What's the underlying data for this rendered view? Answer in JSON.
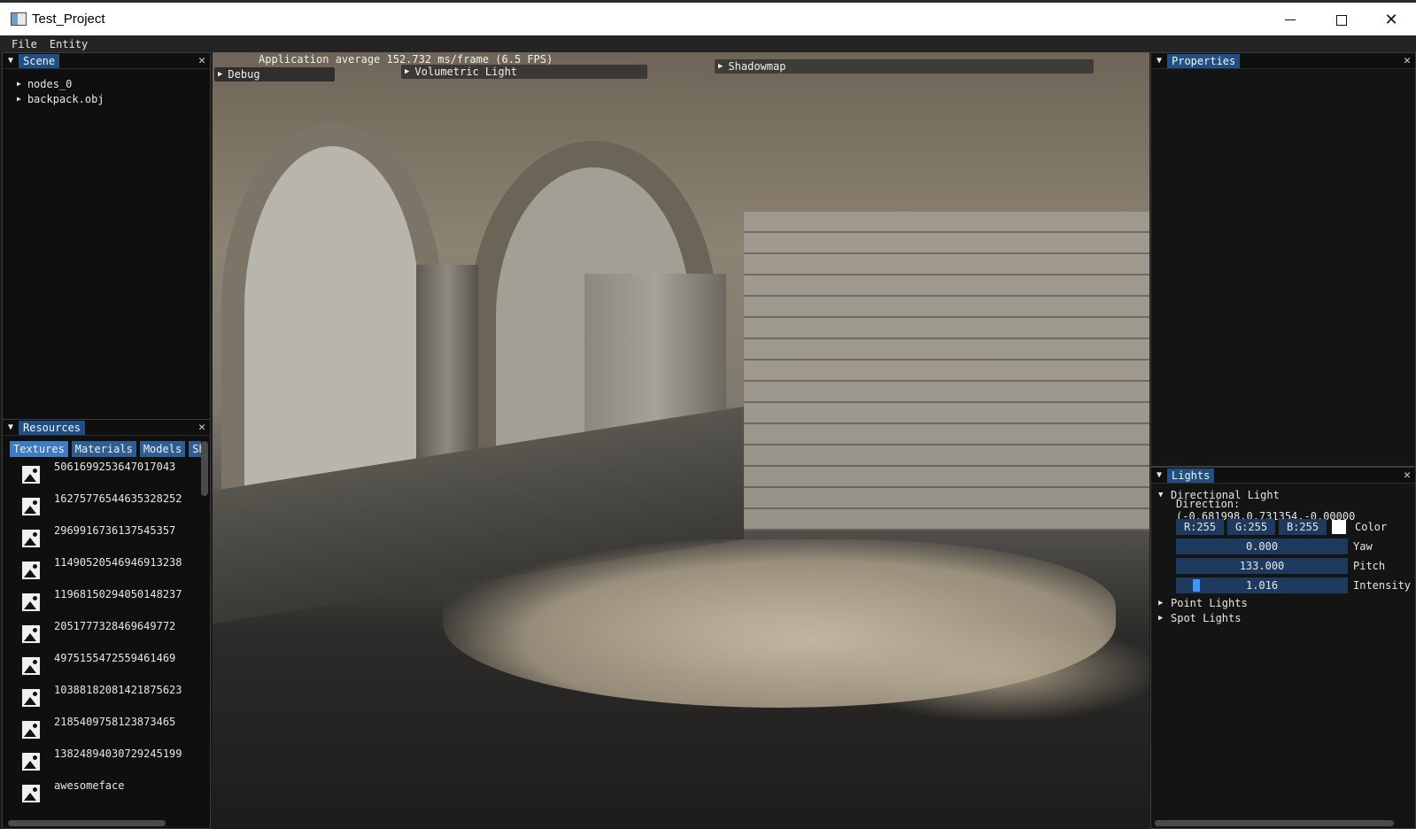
{
  "window": {
    "title": "Test_Project"
  },
  "menubar": {
    "items": [
      "File",
      "Entity"
    ]
  },
  "viewport": {
    "fps_text": "Application average 152.732 ms/frame (6.5 FPS)",
    "collapsers": {
      "debug": "Debug",
      "volumetric": "Volumetric Light",
      "shadowmap": "Shadowmap"
    }
  },
  "scene": {
    "tab": "Scene",
    "nodes": [
      "nodes_0",
      "backpack.obj"
    ]
  },
  "resources": {
    "tab": "Resources",
    "tabs": [
      "Textures",
      "Materials",
      "Models",
      "Sh"
    ],
    "items": [
      "5061699253647017043",
      "16275776544635328252",
      "2969916736137545357",
      "11490520546946913238",
      "11968150294050148237",
      "2051777328469649772",
      "4975155472559461469",
      "10388182081421875623",
      "2185409758123873465",
      "13824894030729245199",
      "awesomeface"
    ]
  },
  "properties": {
    "tab": "Properties"
  },
  "lights": {
    "tab": "Lights",
    "directional": "Directional Light",
    "direction_text": "Direction: (-0.681998,0.731354,-0.00000",
    "color": {
      "r": "R:255",
      "g": "G:255",
      "b": "B:255",
      "label": "Color",
      "swatch": "#ffffff"
    },
    "yaw": {
      "value": "0.000",
      "label": "Yaw"
    },
    "pitch": {
      "value": "133.000",
      "label": "Pitch"
    },
    "intensity": {
      "value": "1.016",
      "label": "Intensity",
      "fraction": 0.1
    },
    "point": "Point Lights",
    "spot": "Spot Lights"
  },
  "colors": {
    "tab_active": "#1f4f84",
    "widget_bg": "#1e3a5f",
    "slider_grab": "#4296fa"
  }
}
